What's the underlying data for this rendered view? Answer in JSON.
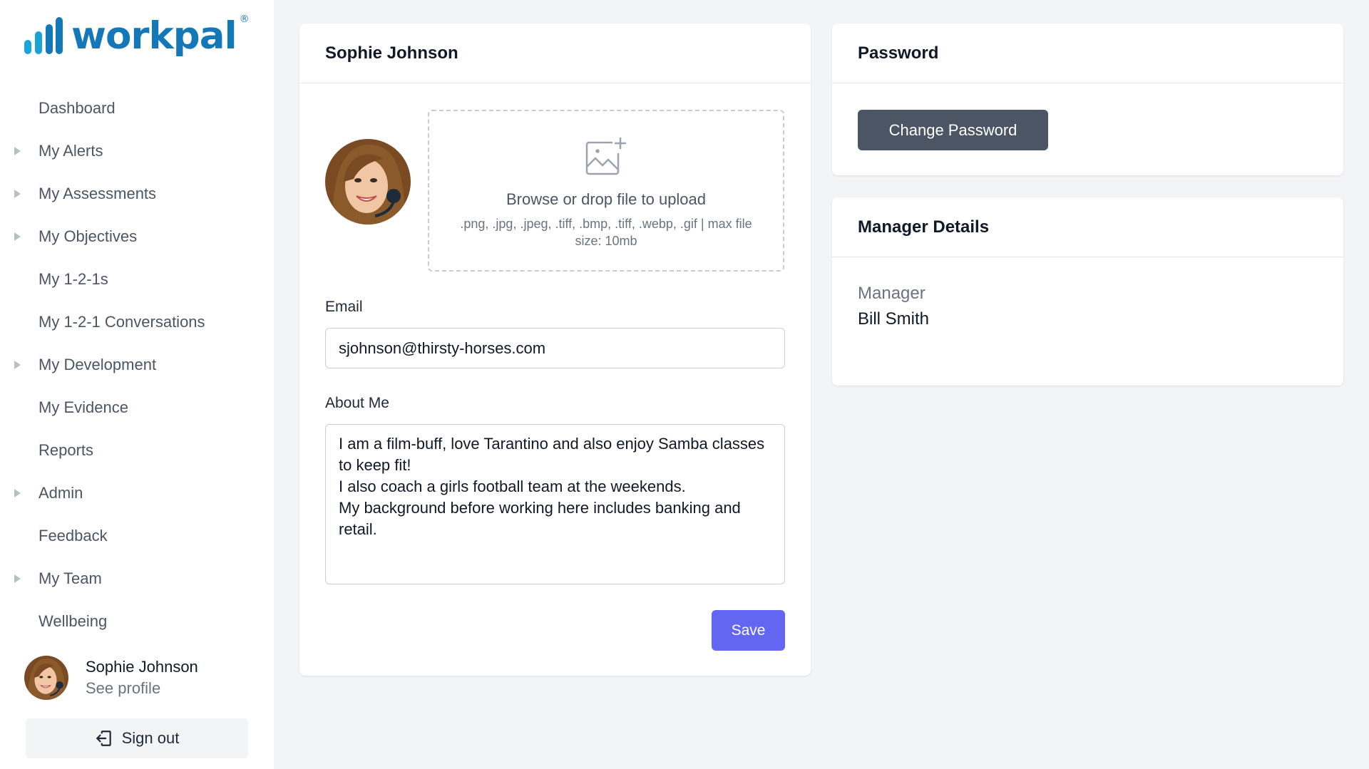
{
  "brand": {
    "name": "workpal",
    "registered_mark": "®",
    "color": "#1478b8"
  },
  "sidebar": {
    "items": [
      {
        "label": "Dashboard",
        "expandable": false
      },
      {
        "label": "My Alerts",
        "expandable": true
      },
      {
        "label": "My Assessments",
        "expandable": true
      },
      {
        "label": "My Objectives",
        "expandable": true
      },
      {
        "label": "My 1-2-1s",
        "expandable": false
      },
      {
        "label": "My 1-2-1 Conversations",
        "expandable": false
      },
      {
        "label": "My Development",
        "expandable": true
      },
      {
        "label": "My Evidence",
        "expandable": false
      },
      {
        "label": "Reports",
        "expandable": false
      },
      {
        "label": "Admin",
        "expandable": true
      },
      {
        "label": "Feedback",
        "expandable": false
      },
      {
        "label": "My Team",
        "expandable": true
      },
      {
        "label": "Wellbeing",
        "expandable": false
      }
    ],
    "user": {
      "name": "Sophie Johnson",
      "profile_link": "See profile"
    },
    "sign_out_label": "Sign out"
  },
  "profile": {
    "title": "Sophie Johnson",
    "upload": {
      "title": "Browse or drop file to upload",
      "hint": ".png, .jpg, .jpeg, .tiff, .bmp, .tiff, .webp, .gif | max file size: 10mb"
    },
    "email_label": "Email",
    "email_value": "sjohnson@thirsty-horses.com",
    "about_label": "About Me",
    "about_value": "I am a film-buff, love Tarantino and also enjoy Samba classes to keep fit!\nI also coach a girls football team at the weekends.\nMy background before working here includes banking and retail.",
    "save_label": "Save"
  },
  "password": {
    "title": "Password",
    "change_label": "Change Password"
  },
  "manager": {
    "title": "Manager Details",
    "label": "Manager",
    "value": "Bill Smith"
  },
  "colors": {
    "primary_button": "#6366f1",
    "secondary_button": "#4b5563",
    "background": "#f3f4f6"
  }
}
